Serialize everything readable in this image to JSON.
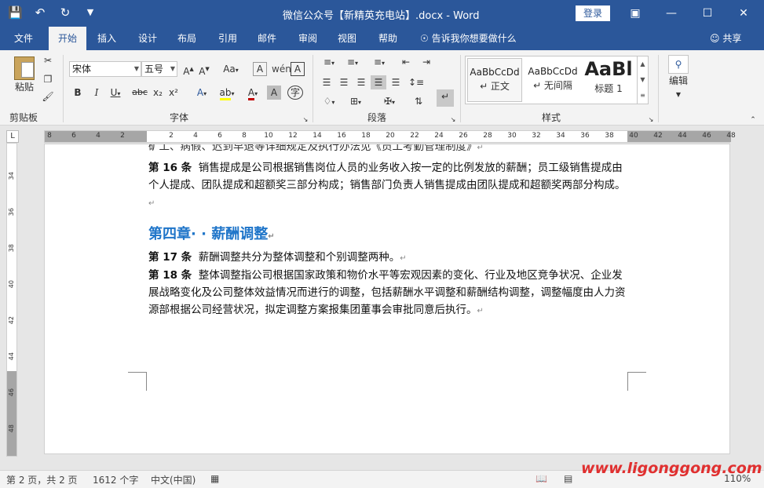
{
  "window": {
    "title": "微信公众号【新精英充电站】.docx - Word",
    "login": "登录",
    "qat": {
      "save": "save-icon",
      "undo": "undo-icon",
      "redo": "redo-icon",
      "customize": "customize-icon"
    }
  },
  "tabs": [
    "文件",
    "开始",
    "插入",
    "设计",
    "布局",
    "引用",
    "邮件",
    "审阅",
    "视图",
    "帮助"
  ],
  "tell_me": "告诉我你想要做什么",
  "share": "共享",
  "ribbon": {
    "clipboard": {
      "paste": "粘贴",
      "label": "剪贴板"
    },
    "font": {
      "family": "宋体",
      "size": "五号",
      "label": "字体",
      "buttons": [
        "B",
        "I",
        "U",
        "abc",
        "x₂",
        "x²",
        "A",
        "A",
        "A",
        "Aa",
        "A",
        "A",
        "wén",
        "字"
      ]
    },
    "paragraph": {
      "label": "段落"
    },
    "styles": {
      "label": "样式",
      "items": [
        {
          "sample": "AaBbCcDd",
          "name": "↵ 正文"
        },
        {
          "sample": "AaBbCcDd",
          "name": "↵ 无间隔"
        },
        {
          "sample": "AaBl",
          "name": "标题 1"
        }
      ]
    },
    "editing": {
      "label": "编辑"
    }
  },
  "ruler": {
    "corner": "L",
    "h_ticks": [
      "8",
      "6",
      "4",
      "2",
      "",
      "2",
      "4",
      "6",
      "8",
      "10",
      "12",
      "14",
      "16",
      "18",
      "20",
      "22",
      "24",
      "26",
      "28",
      "30",
      "32",
      "34",
      "36",
      "38",
      "40",
      "42",
      "44",
      "46",
      "48"
    ],
    "v_ticks": [
      "34",
      "36",
      "38",
      "40",
      "42",
      "44",
      "46",
      "48"
    ]
  },
  "document": {
    "cut_line": "矿工、病假、迟到早退等详细规定及执行办法见《员工考勤管理制度》",
    "p16_label": "第 16 条",
    "p16_text": "销售提成是公司根据销售岗位人员的业务收入按一定的比例发放的薪酬；员工级销售提成由个人提成、团队提成和超额奖三部分构成；销售部门负责人销售提成由团队提成和超额奖两部分构成。",
    "heading": "第四章· · 薪酬调整",
    "p17_label": "第 17 条",
    "p17_text": "薪酬调整共分为整体调整和个别调整两种。",
    "p18_label": "第 18 条",
    "p18_text": "整体调整指公司根据国家政策和物价水平等宏观因素的变化、行业及地区竞争状况、企业发展战略变化及公司整体效益情况而进行的调整，包括薪酬水平调整和薪酬结构调整，调整幅度由人力资源部根据公司经营状况，拟定调整方案报集团董事会审批同意后执行。"
  },
  "status": {
    "page": "第 2 页，共 2 页",
    "words": "1612 个字",
    "lang": "中文(中国)",
    "zoom": "110%"
  },
  "watermark": "www.ligonggong.com"
}
